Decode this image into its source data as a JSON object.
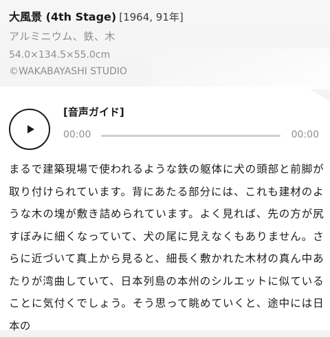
{
  "artwork": {
    "title": "大風景 (4th Stage)",
    "year": "[1964, 91年]",
    "material": "アルミニウム、鉄、木",
    "dimensions": "54.0×134.5×55.0cm",
    "credit": "©WAKABAYASHI STUDIO"
  },
  "audio_guide": {
    "label": "[音声ガイド]",
    "current_time": "00:00",
    "duration": "00:00",
    "progress": 0,
    "play_icon": "play-icon"
  },
  "description": "まるで建築現場で使われるような鉄の躯体に犬の頭部と前脚が取り付けられています。背にあたる部分には、これも建材のような木の塊が敷き詰められています。よく見れば、先の方が尻すぼみに細くなっていて、犬の尾に見えなくもありません。さらに近づいて真上から見ると、細長く敷かれた木材の真ん中あたりが湾曲していて、日本列島の本州のシルエットに似ていることに気付くでしょう。そう思って眺めていくと、途中には日本の"
}
